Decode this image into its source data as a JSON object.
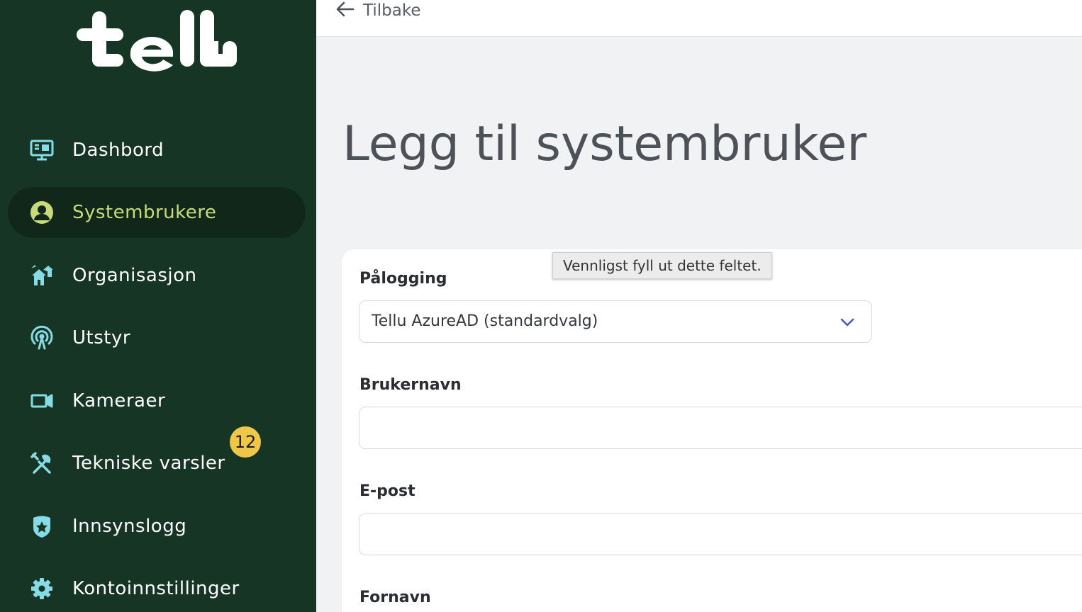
{
  "brand": {
    "logo_text": "tellu",
    "logo_color": "#ffffff"
  },
  "colors": {
    "sidebar_bg": "#163524",
    "sidebar_active_bg": "#10271a",
    "active_text": "#c9da7a",
    "icon": "#86dbe6",
    "badge": "#eec649",
    "chevron": "#4554c4"
  },
  "sidebar": {
    "items": [
      {
        "label": "Dashbord",
        "icon": "monitor-icon"
      },
      {
        "label": "Systembrukere",
        "icon": "user-circle-icon",
        "active": true
      },
      {
        "label": "Organisasjon",
        "icon": "org-houses-icon"
      },
      {
        "label": "Utstyr",
        "icon": "antenna-icon"
      },
      {
        "label": "Kameraer",
        "icon": "video-camera-icon"
      },
      {
        "label": "Tekniske varsler",
        "icon": "tools-icon",
        "badge": "12"
      },
      {
        "label": "Innsynslogg",
        "icon": "badge-star-icon"
      },
      {
        "label": "Kontoinnstillinger",
        "icon": "gear-icon"
      }
    ]
  },
  "topbar": {
    "back_label": "Tilbake"
  },
  "page": {
    "title": "Legg til systembruker"
  },
  "form": {
    "login_label": "Pålogging",
    "login_value": "Tellu AzureAD (standardvalg)",
    "username_label": "Brukernavn",
    "email_label": "E-post",
    "firstname_label": "Fornavn"
  },
  "tooltip": {
    "text": "Vennligst fyll ut dette feltet."
  }
}
